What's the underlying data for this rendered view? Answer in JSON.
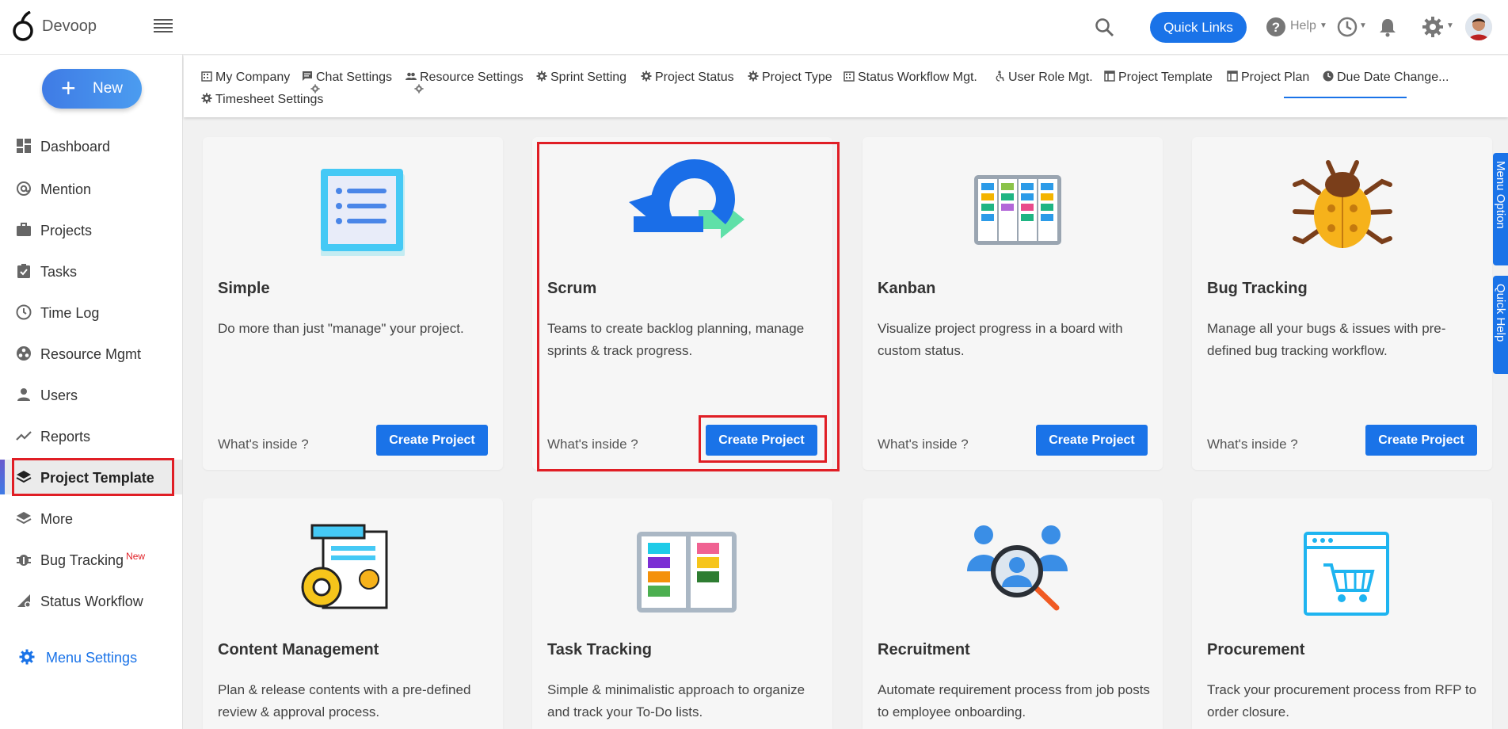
{
  "app": {
    "brand": "Devoop"
  },
  "header": {
    "quick_links": "Quick Links",
    "help": "Help",
    "icons": [
      "search-icon",
      "help-icon",
      "clock-icon",
      "bell-icon",
      "gear-icon",
      "avatar"
    ],
    "accent": "#1a73e8"
  },
  "sidebar": {
    "new_label": "New",
    "items": [
      {
        "label": "Dashboard",
        "icon": "dashboard-icon"
      },
      {
        "label": "Mention",
        "icon": "at-icon"
      },
      {
        "label": "Projects",
        "icon": "briefcase-icon"
      },
      {
        "label": "Tasks",
        "icon": "clipboard-check-icon"
      },
      {
        "label": "Time Log",
        "icon": "clock-icon"
      },
      {
        "label": "Resource Mgmt",
        "icon": "resource-icon"
      },
      {
        "label": "Users",
        "icon": "user-icon"
      },
      {
        "label": "Reports",
        "icon": "trend-icon"
      },
      {
        "label": "Project Template",
        "icon": "layers-icon",
        "active": true
      },
      {
        "label": "More",
        "icon": "layers-icon"
      },
      {
        "label": "Bug Tracking",
        "icon": "bug-icon",
        "badge": "New"
      },
      {
        "label": "Status Workflow",
        "icon": "workflow-icon"
      }
    ],
    "menu_settings": "Menu Settings"
  },
  "tabs": [
    {
      "label": "My Company",
      "icon": "building-icon"
    },
    {
      "label": "Chat Settings",
      "icon": "chat-icon"
    },
    {
      "label": "Resource Settings",
      "icon": "people-icon"
    },
    {
      "label": "Sprint Setting",
      "icon": "gear-icon"
    },
    {
      "label": "Project Status",
      "icon": "gear-icon"
    },
    {
      "label": "Project Type",
      "icon": "gear-icon"
    },
    {
      "label": "Status Workflow Mgt.",
      "icon": "building-icon"
    },
    {
      "label": "User Role Mgt.",
      "icon": "accessibility-icon"
    },
    {
      "label": "Project Template",
      "icon": "template-icon",
      "active": true
    },
    {
      "label": "Project Plan",
      "icon": "template-icon"
    },
    {
      "label": "Due Date Change...",
      "icon": "clock-icon"
    },
    {
      "label": "Timesheet Settings",
      "icon": "gear-icon"
    }
  ],
  "cards": [
    {
      "title": "Simple",
      "desc": "Do more than just \"manage\" your project.",
      "inside": "What's inside ?",
      "button": "Create Project",
      "icon": "list-doc-icon"
    },
    {
      "title": "Scrum",
      "desc": "Teams to create backlog planning, manage sprints & track progress.",
      "inside": "What's inside ?",
      "button": "Create Project",
      "icon": "scrum-cycle-icon"
    },
    {
      "title": "Kanban",
      "desc": "Visualize project progress in a board with custom status.",
      "inside": "What's inside ?",
      "button": "Create Project",
      "icon": "kanban-board-icon"
    },
    {
      "title": "Bug Tracking",
      "desc": "Manage all your bugs & issues with pre-defined bug tracking workflow.",
      "inside": "What's inside ?",
      "button": "Create Project",
      "icon": "bug-icon"
    },
    {
      "title": "Content Management",
      "desc": "Plan & release contents with a pre-defined review & approval process.",
      "icon": "content-gear-doc-icon"
    },
    {
      "title": "Task Tracking",
      "desc": "Simple & minimalistic approach to organize and track your To-Do lists.",
      "icon": "task-board-icon"
    },
    {
      "title": "Recruitment",
      "desc": "Automate requirement process from job posts to employee onboarding.",
      "icon": "recruit-search-icon"
    },
    {
      "title": "Procurement",
      "desc": "Track your procurement process from RFP to order closure.",
      "icon": "cart-window-icon"
    }
  ],
  "side_tabs": [
    "Menu Option",
    "Quick Help"
  ]
}
